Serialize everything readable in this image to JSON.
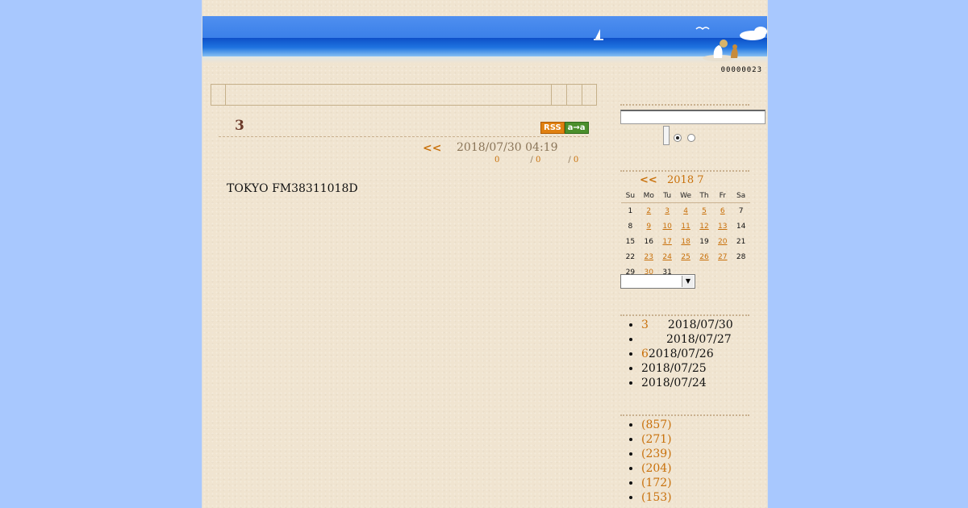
{
  "header": {
    "counter": "00000023"
  },
  "post": {
    "title": "3",
    "prev_label": "<<",
    "date": "2018/07/30 04:19",
    "comments": "0",
    "trackbacks": "0",
    "likes": "0",
    "body": "TOKYO FM38311018D",
    "badges": {
      "rss": "RSS",
      "aa": "a→a"
    }
  },
  "calendar": {
    "prev_label": "<<",
    "year_month": "2018 7",
    "weekdays": [
      "Su",
      "Mo",
      "Tu",
      "We",
      "Th",
      "Fr",
      "Sa"
    ],
    "weeks": [
      [
        {
          "d": "1",
          "l": false
        },
        {
          "d": "2",
          "l": true
        },
        {
          "d": "3",
          "l": true
        },
        {
          "d": "4",
          "l": true
        },
        {
          "d": "5",
          "l": true
        },
        {
          "d": "6",
          "l": true
        },
        {
          "d": "7",
          "l": false
        }
      ],
      [
        {
          "d": "8",
          "l": false
        },
        {
          "d": "9",
          "l": true
        },
        {
          "d": "10",
          "l": true
        },
        {
          "d": "11",
          "l": true
        },
        {
          "d": "12",
          "l": true
        },
        {
          "d": "13",
          "l": true
        },
        {
          "d": "14",
          "l": false
        }
      ],
      [
        {
          "d": "15",
          "l": false
        },
        {
          "d": "16",
          "l": false
        },
        {
          "d": "17",
          "l": true
        },
        {
          "d": "18",
          "l": true
        },
        {
          "d": "19",
          "l": false
        },
        {
          "d": "20",
          "l": true
        },
        {
          "d": "21",
          "l": false
        }
      ],
      [
        {
          "d": "22",
          "l": false
        },
        {
          "d": "23",
          "l": true
        },
        {
          "d": "24",
          "l": true
        },
        {
          "d": "25",
          "l": true
        },
        {
          "d": "26",
          "l": true
        },
        {
          "d": "27",
          "l": true
        },
        {
          "d": "28",
          "l": false
        }
      ],
      [
        {
          "d": "29",
          "l": false
        },
        {
          "d": "30",
          "l": true
        },
        {
          "d": "31",
          "l": false
        },
        {
          "d": "",
          "l": false
        },
        {
          "d": "",
          "l": false
        },
        {
          "d": "",
          "l": false
        },
        {
          "d": "",
          "l": false
        }
      ]
    ]
  },
  "recent_posts": [
    {
      "title": "3",
      "date": "2018/07/30"
    },
    {
      "title": "",
      "date": "2018/07/27"
    },
    {
      "title": "6",
      "date": "2018/07/26"
    },
    {
      "title": "",
      "date": "2018/07/25"
    },
    {
      "title": "",
      "date": "2018/07/24"
    }
  ],
  "categories": [
    "(857)",
    "(271)",
    "(239)",
    "(204)",
    "(172)",
    "(153)"
  ]
}
